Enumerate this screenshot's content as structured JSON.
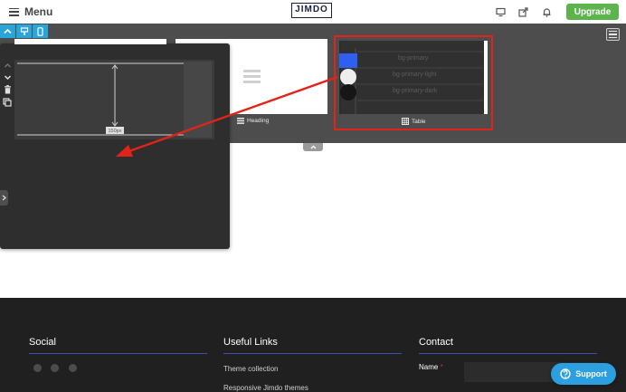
{
  "topbar": {
    "menu_label": "Menu",
    "logo_text": "JIMDO",
    "upgrade_label": "Upgrade"
  },
  "panel": {
    "spacer_value": "150px"
  },
  "cards": {
    "heading_label": "Heading",
    "table_label": "Table",
    "table_rows": [
      "bg-primary",
      "bg-primary-light",
      "bg-primary-dark"
    ]
  },
  "colors": {
    "accent": "#29a5d9",
    "upgrade": "#5db44d",
    "highlight": "#e2231a",
    "support": "#2b9fe0",
    "footer_line": "#3c4fb4"
  },
  "footer": {
    "social_title": "Social",
    "social_icons": [
      "facebook-icon",
      "twitter-icon",
      "instagram-icon"
    ],
    "links_title": "Useful Links",
    "links": [
      "Theme collection",
      "Responsive Jimdo themes"
    ],
    "contact_title": "Contact",
    "name_label": "Name",
    "required_mark": "*"
  },
  "support": {
    "label": "Support"
  }
}
